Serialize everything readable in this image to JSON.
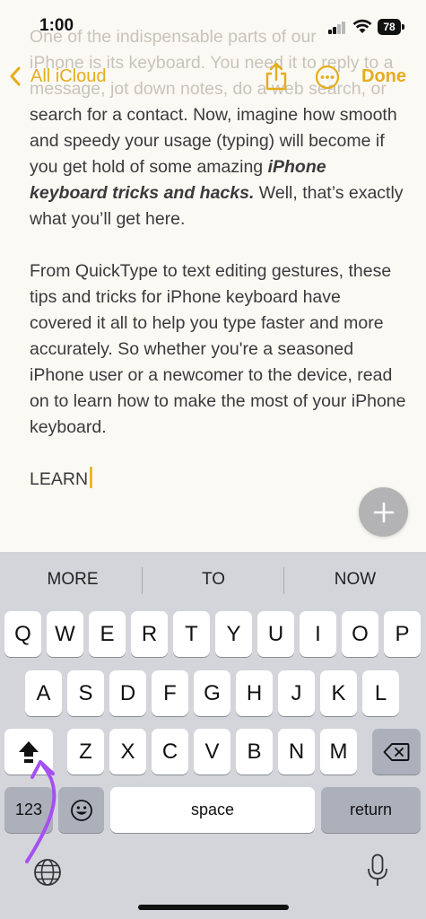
{
  "status_bar": {
    "time": "1:00",
    "battery": "78",
    "icons": [
      "signal-icon",
      "wifi-icon",
      "battery-icon"
    ]
  },
  "nav": {
    "back_label": "All iCloud",
    "done_label": "Done",
    "accent_color": "#e6ad1b",
    "icons": [
      "chevron-left-icon",
      "share-icon",
      "more-icon"
    ]
  },
  "note": {
    "hidden_line_1": "One of the indispensable parts of our",
    "hidden_line_2": "iPhone is its keyboard. You need it to reply to a",
    "hidden_line_3": "message, jot down notes, do a web search, or",
    "p1_pre": "search for a contact. Now, imagine how smooth and speedy your usage (typing) will become if you get hold of some amazing ",
    "p1_bold": "iPhone keyboard tricks and hacks.",
    "p1_post": " Well, that’s exactly what you’ll get here.",
    "p2": "From QuickType to text editing gestures, these tips and tricks for iPhone keyboard have covered it all to help you type faster and more accurately. So whether you're a seasoned iPhone user or a newcomer to the device, read on to learn how to make the most of your iPhone keyboard.",
    "typing": "LEARN"
  },
  "add_button_icon": "plus-icon",
  "keyboard": {
    "predictions": [
      "MORE",
      "TO",
      "NOW"
    ],
    "row1": [
      "Q",
      "W",
      "E",
      "R",
      "T",
      "Y",
      "U",
      "I",
      "O",
      "P"
    ],
    "row2": [
      "A",
      "S",
      "D",
      "F",
      "G",
      "H",
      "J",
      "K",
      "L"
    ],
    "row3": [
      "Z",
      "X",
      "C",
      "V",
      "B",
      "N",
      "M"
    ],
    "numbers_label": "123",
    "space_label": "space",
    "return_label": "return",
    "icons": [
      "shift-icon",
      "delete-icon",
      "emoji-icon",
      "globe-icon",
      "microphone-icon"
    ],
    "annotation_color": "#a64ff0"
  }
}
